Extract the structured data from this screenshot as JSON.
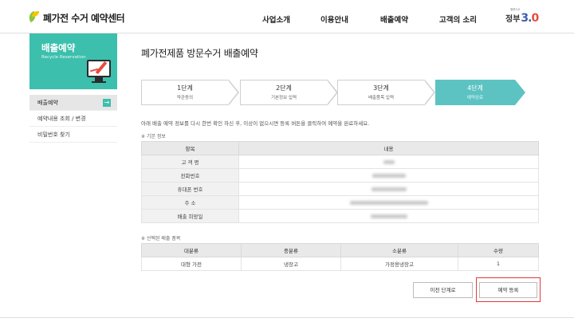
{
  "header": {
    "logo_text": "폐가전 수거 예약센터",
    "nav": [
      "사업소개",
      "이용안내",
      "배출예약",
      "고객의 소리"
    ],
    "gov_logo": {
      "top": "정부3.0",
      "word": "정부",
      "num_main": "3.",
      "num_accent": "0"
    }
  },
  "sidebar": {
    "banner_title": "배출예약",
    "banner_sub": "Recycle Reservation",
    "items": [
      {
        "label": "배출예약",
        "active": true
      },
      {
        "label": "예약내용 조회 / 변경",
        "active": false
      },
      {
        "label": "비밀번호 찾기",
        "active": false
      }
    ],
    "arrow": "→"
  },
  "main": {
    "title": "폐가전제품 방문수거 배출예약",
    "steps": [
      {
        "num": "1단계",
        "name": "약관동의",
        "active": false
      },
      {
        "num": "2단계",
        "name": "기본정보 입력",
        "active": false
      },
      {
        "num": "3단계",
        "name": "배출품목 입력",
        "active": false
      },
      {
        "num": "4단계",
        "name": "예약완료",
        "active": true
      }
    ],
    "guide": "아래 배출 예약 정보를 다시 한번 확인 하신 후, 이상이 없으시면 등록 버튼을 클릭하여 예약을 완료하세요.",
    "basic_section": "※ 기본 정보",
    "basic_table": {
      "headers": [
        "항목",
        "내용"
      ],
      "rows": [
        "고 객 명",
        "전화번호",
        "휴대폰 번호",
        "주 소",
        "배출 희망일"
      ]
    },
    "items_section": "※ 선택된 배출 품목",
    "items_table": {
      "headers": [
        "대분류",
        "중분류",
        "소분류",
        "수량"
      ],
      "rows": [
        [
          "대형 가전",
          "냉장고",
          "가정용냉장고",
          "1"
        ]
      ]
    },
    "buttons": {
      "prev": "이전 단계로",
      "submit": "예약 등록"
    }
  },
  "colors": {
    "accent": "#3dbfad",
    "step_active": "#5cc3c2",
    "highlight": "#e03a3a"
  }
}
